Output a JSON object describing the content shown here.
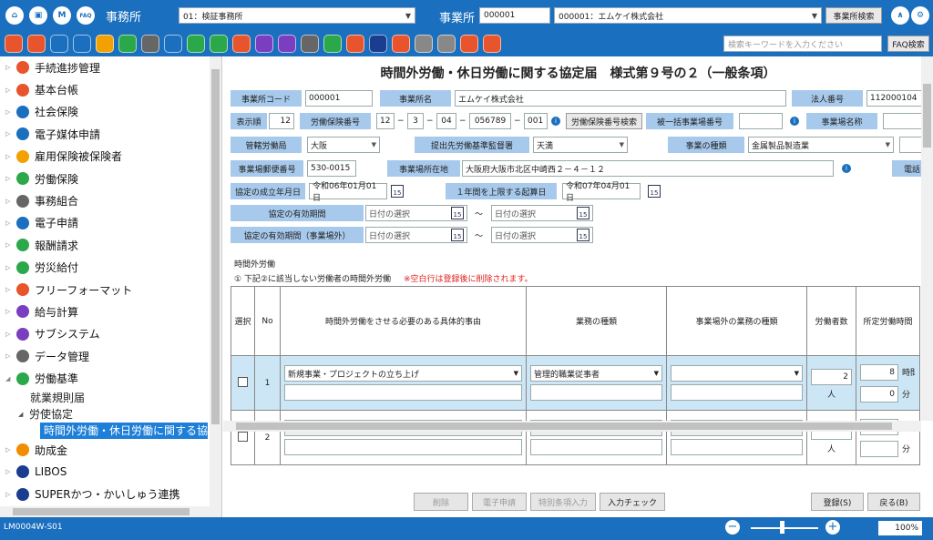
{
  "topbar": {
    "faq_icon": "FAQ",
    "office_label": "事務所",
    "office_value": "01：検証事務所",
    "site_label": "事業所",
    "site_code": "000001",
    "site_value": "000001：エムケイ株式会社",
    "site_search": "事業所検索",
    "search_placeholder": "検索キーワードを入力ください",
    "faq_search": "FAQ検索"
  },
  "icon_colors": [
    "#e8542b",
    "#e8542b",
    "#1a6fbe",
    "#1a6fbe",
    "#f2a100",
    "#2aa84a",
    "#666",
    "#1a6fbe",
    "#2aa84a",
    "#2aa84a",
    "#e8542b",
    "#7a3fc0",
    "#7a3fc0",
    "#666",
    "#2aa84a",
    "#e8542b",
    "#1a3d8f",
    "#e8542b",
    "#888",
    "#888",
    "#e8542b",
    "#e8542b"
  ],
  "sidebar": {
    "items": [
      {
        "label": "手続進捗管理",
        "color": "#e8542b"
      },
      {
        "label": "基本台帳",
        "color": "#e8542b"
      },
      {
        "label": "社会保険",
        "color": "#1a6fbe"
      },
      {
        "label": "電子媒体申請",
        "color": "#1a6fbe"
      },
      {
        "label": "雇用保険被保険者",
        "color": "#f2a100"
      },
      {
        "label": "労働保険",
        "color": "#2aa84a"
      },
      {
        "label": "事務組合",
        "color": "#666"
      },
      {
        "label": "電子申請",
        "color": "#1a6fbe"
      },
      {
        "label": "報酬請求",
        "color": "#2aa84a"
      },
      {
        "label": "労災給付",
        "color": "#2aa84a"
      },
      {
        "label": "フリーフォーマット",
        "color": "#e8542b"
      },
      {
        "label": "給与計算",
        "color": "#7a3fc0"
      },
      {
        "label": "サブシステム",
        "color": "#7a3fc0"
      },
      {
        "label": "データ管理",
        "color": "#666"
      },
      {
        "label": "労働基準",
        "color": "#2aa84a"
      }
    ],
    "sub1": "就業規則届",
    "sub2": "労使協定",
    "sub3": "時間外労働・休日労働に関する協",
    "after": [
      {
        "label": "助成金",
        "color": "#f28c00"
      },
      {
        "label": "LIBOS",
        "color": "#1a3d8f"
      },
      {
        "label": "SUPERかつ・かいしゅう連携",
        "color": "#1a3d8f"
      }
    ]
  },
  "form": {
    "title": "時間外労働・休日労働に関する協定届　様式第９号の２（一般条項）",
    "office_code_label": "事業所コード",
    "office_code": "000001",
    "office_name_label": "事業所名",
    "office_name": "エムケイ株式会社",
    "corp_no_label": "法人番号",
    "corp_no": "112000104",
    "display_order_label": "表示順",
    "display_order": "12",
    "labor_ins_label": "労働保険番号",
    "li1": "12",
    "li2": "3",
    "li3": "04",
    "li4": "056789",
    "li5": "001",
    "dash": "−",
    "labor_ins_search": "労働保険番号検索",
    "bulk_label": "被一括事業場番号",
    "site_name_label": "事業場名称",
    "bureau_label": "管轄労働局",
    "bureau": "大阪",
    "office_sub_label": "提出先労働基準監督署",
    "office_sub": "天満",
    "biz_type_label": "事業の種類",
    "biz_type": "金属製品製造業",
    "zip_label": "事業場郵便番号",
    "zip": "530-0015",
    "address_label": "事業場所在地",
    "address": "大阪府大阪市北区中崎西２－４－１２",
    "tel_label": "電話",
    "agree_date_label": "協定の成立年月日",
    "agree_date": "令和06年01月01日",
    "start_label": "１年間を上限する起算日",
    "start_date": "令和07年04月01日",
    "valid_label": "協定の有効期間",
    "valid_out_label": "協定の有効期間（事業場外）",
    "date_placeholder": "日付の選択",
    "tilde": "～",
    "cal_num": "15",
    "info": "i",
    "section1": "時間外労働",
    "section2": "① 下記②に該当しない労働者の時間外労働",
    "section_note": "※空白行は登録後に削除されます。"
  },
  "table": {
    "headers": [
      "選択",
      "No",
      "時間外労働をさせる必要のある具体的事由",
      "業務の種類",
      "事業場外の業務の種類",
      "労働者数",
      "所定労働時間"
    ],
    "row1": {
      "no": "1",
      "reason": "新規事業・プロジェクトの立ち上げ",
      "work": "管理的職業従事者",
      "workers": "2",
      "hours": "8",
      "minutes": "0"
    },
    "row2": {
      "no": "2"
    },
    "unit_person": "人",
    "unit_hour": "時間",
    "unit_min": "分"
  },
  "footer": {
    "delete": "削除",
    "e_apply": "電子申請",
    "special": "特別条項入力",
    "check": "入力チェック",
    "register": "登録(S)",
    "back": "戻る(B)",
    "screen_id": "LM0004W-S01",
    "zoom": "100%",
    "minus": "−",
    "plus": "+"
  }
}
